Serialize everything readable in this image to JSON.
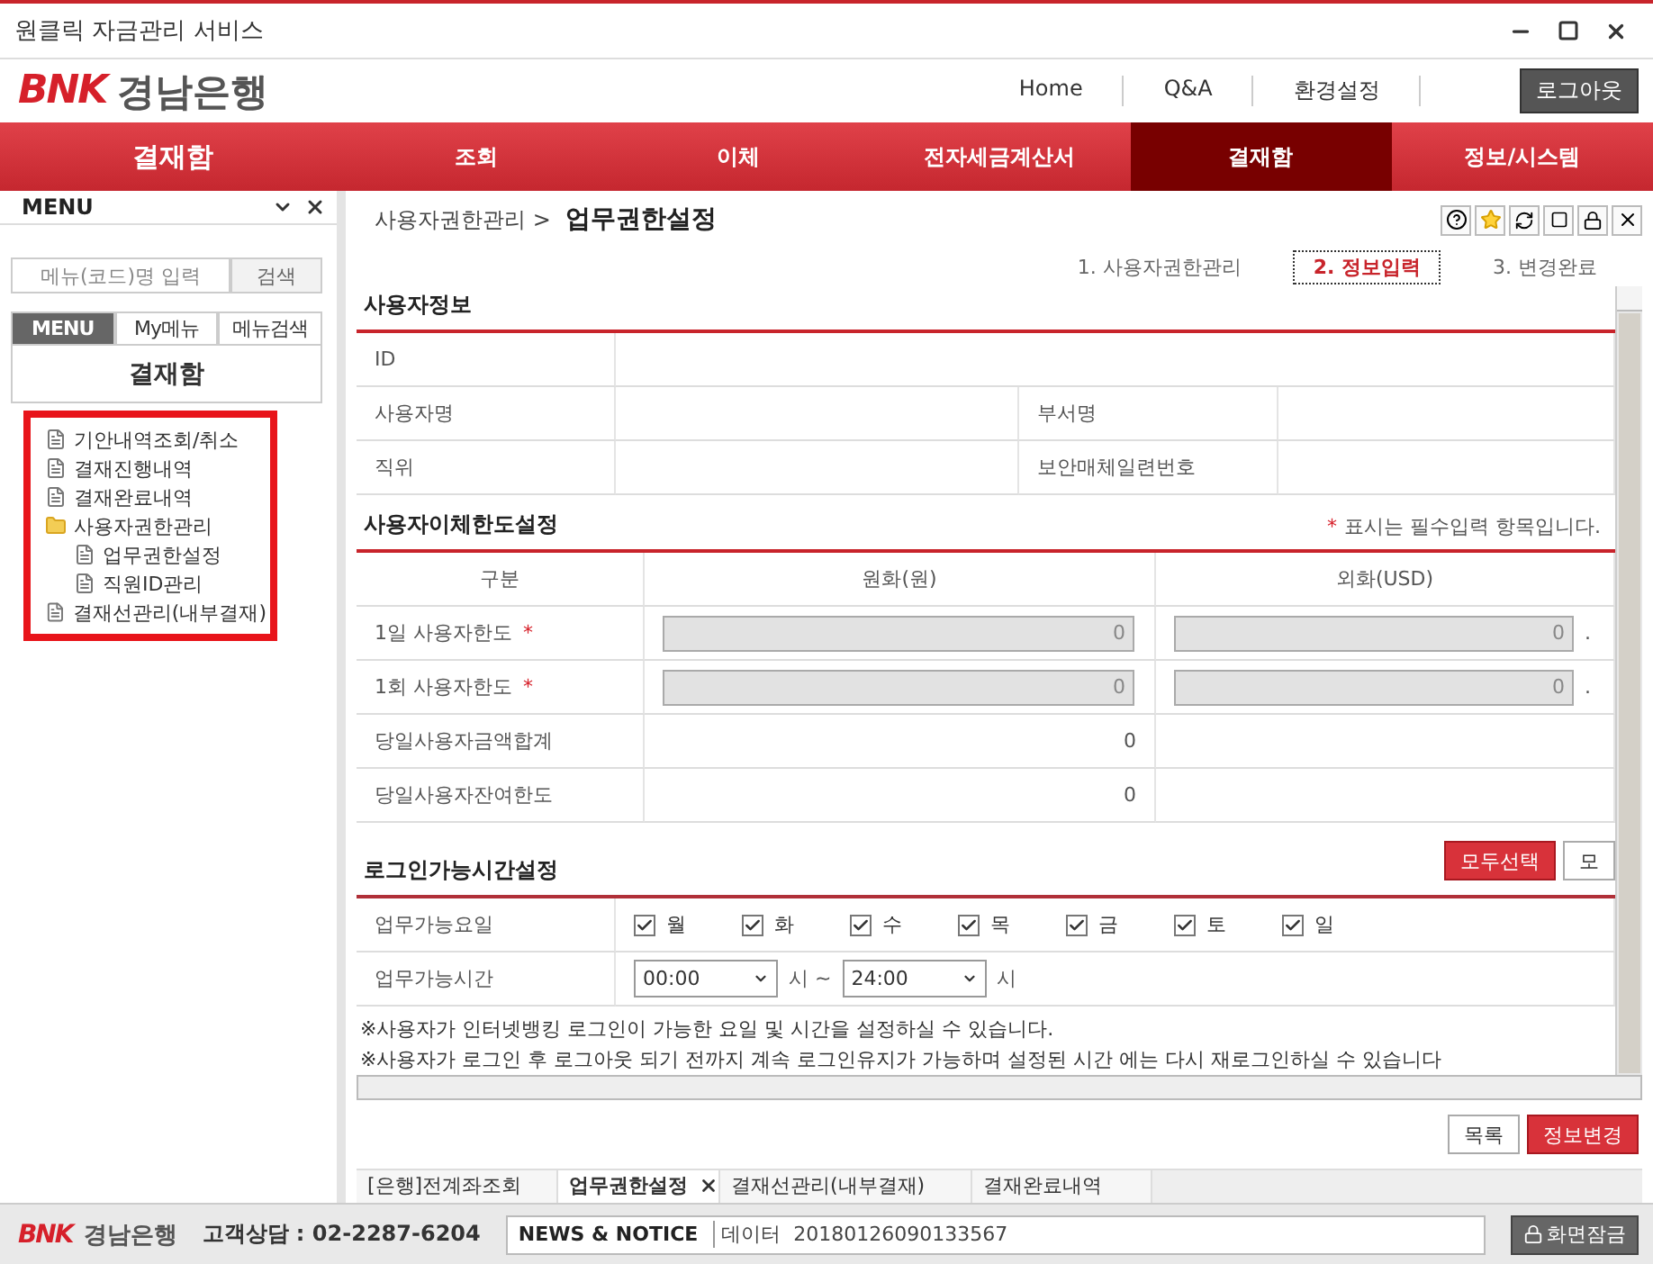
{
  "window": {
    "title": "원클릭 자금관리 서비스"
  },
  "header": {
    "logo_mark": "BNK",
    "logo_text": "경남은행",
    "links": [
      "Home",
      "Q&A",
      "환경설정"
    ],
    "logout": "로그아웃"
  },
  "nav": {
    "section_title": "결재함",
    "items": [
      {
        "label": "조회",
        "selected": false
      },
      {
        "label": "이체",
        "selected": false
      },
      {
        "label": "전자세금계산서",
        "selected": false
      },
      {
        "label": "결재함",
        "selected": true
      },
      {
        "label": "정보/시스템",
        "selected": false
      }
    ]
  },
  "sidebar": {
    "title": "MENU",
    "search": {
      "placeholder": "메뉴(코드)명 입력",
      "button": "검색"
    },
    "tabs": [
      {
        "label": "MENU",
        "selected": true
      },
      {
        "label": "My메뉴",
        "selected": false
      },
      {
        "label": "메뉴검색",
        "selected": false
      }
    ],
    "heading": "결재함",
    "tree_highlighted": true,
    "tree": [
      {
        "label": "기안내역조회/취소",
        "kind": "page"
      },
      {
        "label": "결재진행내역",
        "kind": "page"
      },
      {
        "label": "결재완료내역",
        "kind": "page"
      },
      {
        "label": "사용자권한관리",
        "kind": "folder",
        "children": [
          {
            "label": "업무권한설정",
            "kind": "page"
          },
          {
            "label": "직원ID관리",
            "kind": "page"
          }
        ]
      },
      {
        "label": "결재선관리(내부결재)",
        "kind": "page"
      }
    ]
  },
  "main": {
    "breadcrumb": {
      "parent": "사용자권한관리 >",
      "current": "업무권한설정"
    },
    "steps": [
      {
        "label": "1. 사용자권한관리",
        "selected": false
      },
      {
        "label": "2. 정보입력",
        "selected": true
      },
      {
        "label": "3. 변경완료",
        "selected": false
      }
    ],
    "user_info": {
      "title": "사용자정보",
      "id_label": "ID",
      "fields": [
        {
          "label": "사용자명"
        },
        {
          "label": "부서명"
        },
        {
          "label": "직위"
        },
        {
          "label": "보안매체일련번호"
        }
      ]
    },
    "limits": {
      "title": "사용자이체한도설정",
      "note_mark": "*",
      "note": "표시는 필수입력 항목입니다.",
      "columns": [
        "구분",
        "원화(원)",
        "외화(USD)"
      ],
      "rows": [
        {
          "label": "1일 사용자한도",
          "required": true,
          "kind": "input",
          "krw": "0",
          "usd": "0",
          "usd_sep": "."
        },
        {
          "label": "1회 사용자한도",
          "required": true,
          "kind": "input",
          "krw": "0",
          "usd": "0",
          "usd_sep": "."
        },
        {
          "label": "당일사용자금액합계",
          "required": false,
          "kind": "text",
          "krw": "0"
        },
        {
          "label": "당일사용자잔여한도",
          "required": false,
          "kind": "text",
          "krw": "0"
        }
      ]
    },
    "login_time": {
      "title": "로그인가능시간설정",
      "buttons": [
        {
          "label": "모두선택",
          "kind": "primary"
        },
        {
          "label": "모",
          "kind": "plain"
        }
      ],
      "days_label": "업무가능요일",
      "days": [
        {
          "label": "월",
          "checked": true
        },
        {
          "label": "화",
          "checked": true
        },
        {
          "label": "수",
          "checked": true
        },
        {
          "label": "목",
          "checked": true
        },
        {
          "label": "금",
          "checked": true
        },
        {
          "label": "토",
          "checked": true
        },
        {
          "label": "일",
          "checked": true
        }
      ],
      "time_label": "업무가능시간",
      "start": "00:00",
      "start_unit": "시 ~",
      "end": "24:00",
      "end_unit": "시",
      "notes": [
        "※사용자가 인터넷뱅킹 로그인이 가능한 요일 및 시간을 설정하실 수 있습니다.",
        "※사용자가 로그인 후 로그아웃 되기 전까지 계속 로그인유지가 가능하며 설정된 시간 에는 다시 재로그인하실 수 있습니다"
      ]
    },
    "actions": [
      {
        "label": "목록",
        "kind": "plain"
      },
      {
        "label": "정보변경",
        "kind": "primary"
      }
    ]
  },
  "tabs": [
    {
      "label": "[은행]전계좌조회",
      "selected": false,
      "closable": false
    },
    {
      "label": "업무권한설정",
      "selected": true,
      "closable": true
    },
    {
      "label": "결재선관리(내부결재)",
      "selected": false,
      "closable": false
    },
    {
      "label": "결재완료내역",
      "selected": false,
      "closable": false
    }
  ],
  "footer": {
    "logo_mark": "BNK",
    "logo_text": "경남은행",
    "contact_label": "고객상담 :",
    "contact_number": "02-2287-6204",
    "news_label": "NEWS & NOTICE",
    "news_text": "데이터  20180126090133567",
    "lock": "화면잠금"
  }
}
